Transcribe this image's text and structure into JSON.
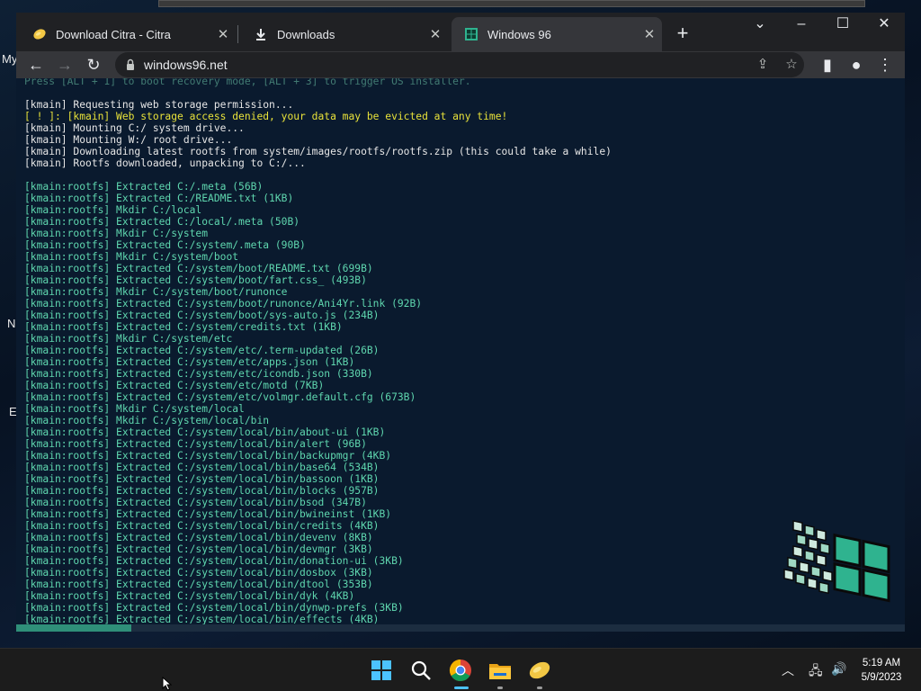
{
  "browser": {
    "tabs": [
      {
        "title": "Download Citra - Citra",
        "favicon": "citra-lemon-icon",
        "active": false
      },
      {
        "title": "Downloads",
        "favicon": "download-icon",
        "active": false
      },
      {
        "title": "Windows 96",
        "favicon": "windows96-icon",
        "active": true
      }
    ],
    "url": "windows96.net"
  },
  "desktop": {
    "fragments": [
      "My",
      "N",
      "E"
    ]
  },
  "terminal": {
    "lines": [
      {
        "text": "Press [ALT + 1] to boot recovery mode, [ALT + 3] to trigger OS installer.",
        "color": "faded"
      },
      {
        "text": "",
        "color": "blank"
      },
      {
        "text": "[kmain] Requesting web storage permission...",
        "color": "white"
      },
      {
        "text": "[ ! ]: [kmain] Web storage access denied, your data may be evicted at any time!",
        "color": "yellow"
      },
      {
        "text": "[kmain] Mounting C:/ system drive...",
        "color": "white"
      },
      {
        "text": "[kmain] Mounting W:/ root drive...",
        "color": "white"
      },
      {
        "text": "[kmain] Downloading latest rootfs from system/images/rootfs/rootfs.zip (this could take a while)",
        "color": "white"
      },
      {
        "text": "[kmain] Rootfs downloaded, unpacking to C:/...",
        "color": "white"
      },
      {
        "text": "",
        "color": "blank"
      },
      {
        "text": "[kmain:rootfs] Extracted C:/.meta (56B)",
        "color": "green"
      },
      {
        "text": "[kmain:rootfs] Extracted C:/README.txt (1KB)",
        "color": "green"
      },
      {
        "text": "[kmain:rootfs] Mkdir C:/local",
        "color": "green"
      },
      {
        "text": "[kmain:rootfs] Extracted C:/local/.meta (50B)",
        "color": "green"
      },
      {
        "text": "[kmain:rootfs] Mkdir C:/system",
        "color": "green"
      },
      {
        "text": "[kmain:rootfs] Extracted C:/system/.meta (90B)",
        "color": "green"
      },
      {
        "text": "[kmain:rootfs] Mkdir C:/system/boot",
        "color": "green"
      },
      {
        "text": "[kmain:rootfs] Extracted C:/system/boot/README.txt (699B)",
        "color": "green"
      },
      {
        "text": "[kmain:rootfs] Extracted C:/system/boot/fart.css_ (493B)",
        "color": "green"
      },
      {
        "text": "[kmain:rootfs] Mkdir C:/system/boot/runonce",
        "color": "green"
      },
      {
        "text": "[kmain:rootfs] Extracted C:/system/boot/runonce/Ani4Yr.link (92B)",
        "color": "green"
      },
      {
        "text": "[kmain:rootfs] Extracted C:/system/boot/sys-auto.js (234B)",
        "color": "green"
      },
      {
        "text": "[kmain:rootfs] Extracted C:/system/credits.txt (1KB)",
        "color": "green"
      },
      {
        "text": "[kmain:rootfs] Mkdir C:/system/etc",
        "color": "green"
      },
      {
        "text": "[kmain:rootfs] Extracted C:/system/etc/.term-updated (26B)",
        "color": "green"
      },
      {
        "text": "[kmain:rootfs] Extracted C:/system/etc/apps.json (1KB)",
        "color": "green"
      },
      {
        "text": "[kmain:rootfs] Extracted C:/system/etc/icondb.json (330B)",
        "color": "green"
      },
      {
        "text": "[kmain:rootfs] Extracted C:/system/etc/motd (7KB)",
        "color": "green"
      },
      {
        "text": "[kmain:rootfs] Extracted C:/system/etc/volmgr.default.cfg (673B)",
        "color": "green"
      },
      {
        "text": "[kmain:rootfs] Mkdir C:/system/local",
        "color": "green"
      },
      {
        "text": "[kmain:rootfs] Mkdir C:/system/local/bin",
        "color": "green"
      },
      {
        "text": "[kmain:rootfs] Extracted C:/system/local/bin/about-ui (1KB)",
        "color": "green"
      },
      {
        "text": "[kmain:rootfs] Extracted C:/system/local/bin/alert (96B)",
        "color": "green"
      },
      {
        "text": "[kmain:rootfs] Extracted C:/system/local/bin/backupmgr (4KB)",
        "color": "green"
      },
      {
        "text": "[kmain:rootfs] Extracted C:/system/local/bin/base64 (534B)",
        "color": "green"
      },
      {
        "text": "[kmain:rootfs] Extracted C:/system/local/bin/bassoon (1KB)",
        "color": "green"
      },
      {
        "text": "[kmain:rootfs] Extracted C:/system/local/bin/blocks (957B)",
        "color": "green"
      },
      {
        "text": "[kmain:rootfs] Extracted C:/system/local/bin/bsod (347B)",
        "color": "green"
      },
      {
        "text": "[kmain:rootfs] Extracted C:/system/local/bin/bwineinst (1KB)",
        "color": "green"
      },
      {
        "text": "[kmain:rootfs] Extracted C:/system/local/bin/credits (4KB)",
        "color": "green"
      },
      {
        "text": "[kmain:rootfs] Extracted C:/system/local/bin/devenv (8KB)",
        "color": "green"
      },
      {
        "text": "[kmain:rootfs] Extracted C:/system/local/bin/devmgr (3KB)",
        "color": "green"
      },
      {
        "text": "[kmain:rootfs] Extracted C:/system/local/bin/donation-ui (3KB)",
        "color": "green"
      },
      {
        "text": "[kmain:rootfs] Extracted C:/system/local/bin/dosbox (3KB)",
        "color": "green"
      },
      {
        "text": "[kmain:rootfs] Extracted C:/system/local/bin/dtool (353B)",
        "color": "green"
      },
      {
        "text": "[kmain:rootfs] Extracted C:/system/local/bin/dyk (4KB)",
        "color": "green"
      },
      {
        "text": "[kmain:rootfs] Extracted C:/system/local/bin/dynwp-prefs (3KB)",
        "color": "green"
      },
      {
        "text": "[kmain:rootfs] Extracted C:/system/local/bin/effects (4KB)",
        "color": "green"
      }
    ],
    "progress_fraction": 0.13
  },
  "taskbar": {
    "apps": [
      "start-icon",
      "search-icon",
      "chrome-icon",
      "file-explorer-icon",
      "citra-icon"
    ],
    "time": "5:19 AM",
    "date": "5/9/2023"
  },
  "colors": {
    "terminal_green": "#5fd7af",
    "terminal_yellow": "#e8e23a",
    "terminal_white": "#e6e6e6",
    "active_tab": "#35363a",
    "progress": "#2f8f79"
  }
}
